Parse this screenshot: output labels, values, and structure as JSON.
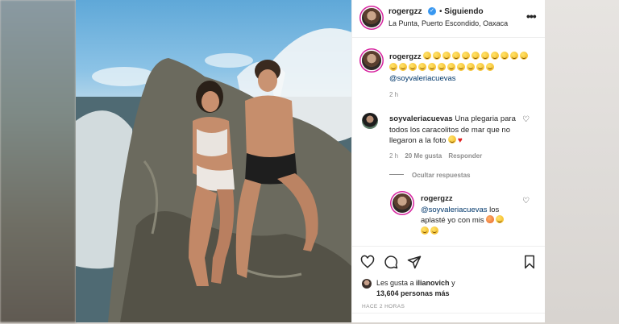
{
  "post": {
    "username": "rogergzz",
    "follow_separator": "•",
    "follow_status": "Siguiendo",
    "location": "La Punta, Puerto Escondido, Oaxaca"
  },
  "caption": {
    "username": "rogergzz",
    "mention": "@soyvaleriacuevas",
    "age": "2 h",
    "emoji_count": 22,
    "emoji_name": "grinning-face-emoji"
  },
  "comment": {
    "username": "soyvaleriacuevas",
    "text": "Una plegaria para todos los caracolitos de mar que no llegaron a la foto",
    "age": "2 h",
    "likes": "20 Me gusta",
    "reply_label": "Responder",
    "hide_replies": "Ocultar respuestas"
  },
  "reply": {
    "username": "rogergzz",
    "mention": "@soyvaleriacuevas",
    "text": " los aplasté yo con mis "
  },
  "likes": {
    "prefix": "Les gusta a ",
    "user": "ilianovich",
    "connector": " y",
    "count_text": "13,604 personas más"
  },
  "timestamp": "HACE 2 HORAS",
  "colors": {
    "verified": "#3897f0",
    "mention": "#00376b",
    "muted": "#8e8e8e",
    "story_ring": "#d6249f"
  }
}
